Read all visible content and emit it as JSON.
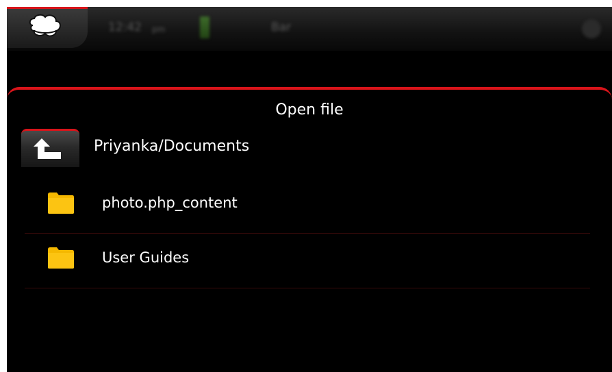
{
  "colors": {
    "accent": "#d8141a",
    "background": "#000000",
    "text": "#ffffff",
    "folder": "#f5b800"
  },
  "statusbar": {
    "time": "12:42",
    "time_suffix": "pm",
    "network": "Bar",
    "icons": [
      "cloud-icon",
      "battery-icon",
      "menu-icon"
    ]
  },
  "dialog": {
    "title": "Open file",
    "up_icon": "up-arrow-icon",
    "current_path": "Priyanka/Documents",
    "items": [
      {
        "label": "photo.php_content",
        "icon": "folder-icon"
      },
      {
        "label": "User Guides",
        "icon": "folder-icon"
      }
    ]
  }
}
